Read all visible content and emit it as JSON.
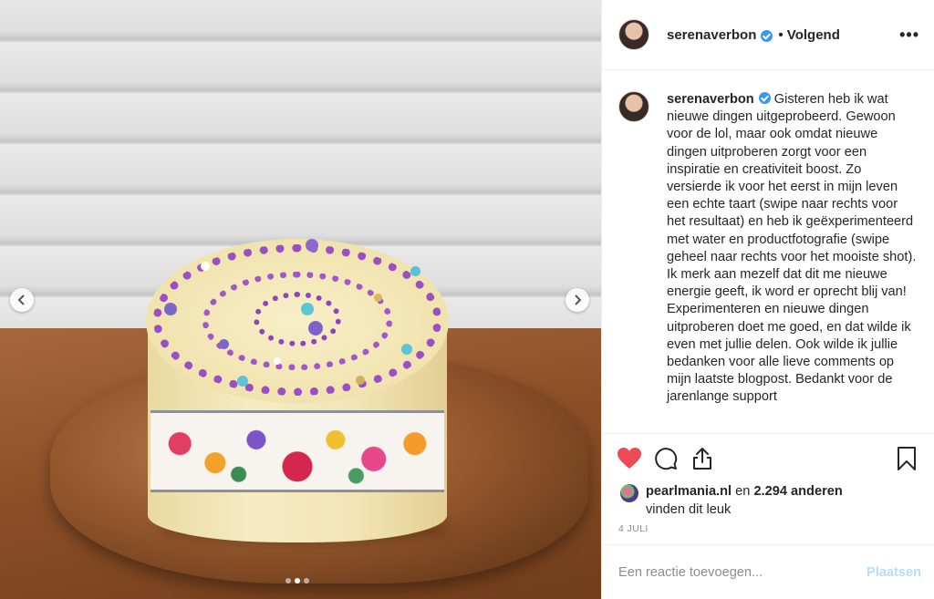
{
  "post": {
    "photo_alt": "",
    "carousel": {
      "count": 3,
      "active": 2
    }
  },
  "header": {
    "username": "serenaverbon",
    "follow_state": "• Volgend",
    "more": "•••"
  },
  "caption": {
    "username": "serenaverbon",
    "text": "Gisteren heb ik wat nieuwe dingen uitgeprobeerd. Gewoon voor de lol, maar ook omdat nieuwe dingen uitproberen zorgt voor een inspiratie en creativiteit boost. Zo versierde ik voor het eerst in mijn leven een echte taart (swipe naar rechts voor het resultaat) en heb ik geëxperimenteerd met water en productfotografie (swipe geheel naar rechts voor het mooiste shot). Ik merk aan mezelf dat dit me nieuwe energie geeft, ik word er oprecht blij van! Experimenteren en nieuwe dingen uitproberen doet me goed, en dat wilde ik even met jullie delen. Ook wilde ik jullie bedanken voor alle lieve comments op mijn laatste blogpost. Bedankt voor de jarenlange support"
  },
  "likes": {
    "user": "pearlmania.nl",
    "connector": " en ",
    "count": "2.294 anderen",
    "suffix": "vinden dit leuk"
  },
  "date": "4 JULI",
  "comment_box": {
    "placeholder": "Een reactie toevoegen...",
    "post_label": "Plaatsen"
  },
  "colors": {
    "like_heart": "#ed4956",
    "verified": "#3897f0",
    "post_button_disabled": "#b2dffc",
    "secondary_text": "#8e8e8e"
  },
  "icons": [
    "heart-icon",
    "comment-icon",
    "share-icon",
    "bookmark-icon",
    "chevron-left-icon",
    "chevron-right-icon",
    "verified-badge-icon"
  ]
}
